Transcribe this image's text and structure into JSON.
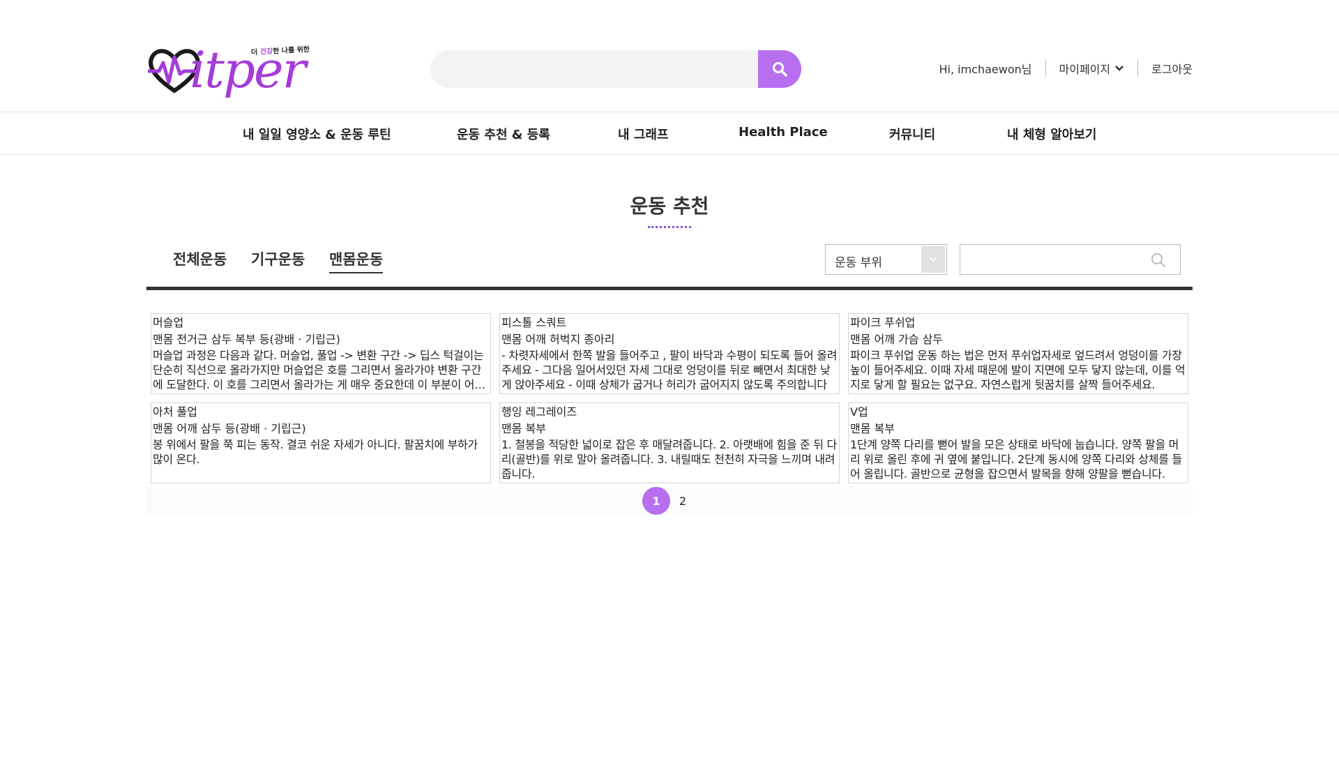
{
  "brand": {
    "name": "Fitper",
    "logo_text": "itper",
    "tagline_pre": "더 ",
    "tagline_highlight": "건강",
    "tagline_post": "한 나를 위한"
  },
  "header": {
    "search_placeholder": "",
    "greeting": "Hi, imchaewon님",
    "mypage_label": "마이페이지",
    "logout_label": "로그아웃"
  },
  "nav": {
    "items": [
      {
        "label": "내 일일 영양소 & 운동 루틴"
      },
      {
        "label": "운동 추천 & 등록"
      },
      {
        "label": "내 그래프"
      },
      {
        "label": "Health Place"
      },
      {
        "label": "커뮤니티"
      },
      {
        "label": "내 체형 알아보기"
      }
    ]
  },
  "page": {
    "title": "운동 추천"
  },
  "tabs": [
    {
      "label": "전체운동",
      "active": false
    },
    {
      "label": "기구운동",
      "active": false
    },
    {
      "label": "맨몸운동",
      "active": true
    }
  ],
  "filters": {
    "body_part_label": "운동 부위",
    "search_placeholder": ""
  },
  "exercises": [
    {
      "name": "머슬업",
      "target": "맨몸 전거근 삼두 복부 등(광배 · 기립근)",
      "description": "머슬업 과정은 다음과 같다. 머슬업, 풀업 -> 변환 구간 -> 딥스 턱걸이는 단순히 직선으로 올라가지만 머슬업은 호를 그리면서 올라가야 변환 구간에 도달한다. 이 호를 그리면서 올라가는 게 매우 중요한데 이 부분이 어렵다."
    },
    {
      "name": "피스톨 스쿼트",
      "target": "맨몸 어깨 허벅지 종아리",
      "description": "- 차렷자세에서 한쪽 발을 들어주고 , 팔이 바닥과 수평이 되도록 들어 올려주세요 - 그다음 일어서있던 자세 그대로 엉덩이를 뒤로 빼면서 최대한 낮게 앉아주세요 - 이때 상체가 굽거나 허리가 굽어지지 않도록 주의합니다"
    },
    {
      "name": "파이크 푸쉬업",
      "target": "맨몸 어깨 가슴 삼두",
      "description": "파이크 푸쉬업 운동 하는 법은 먼저 푸쉬업자세로 엎드려서 엉덩이를 가장 높이 들어주세요. 이때 자세 때문에 발이 지면에 모두 닿지 않는데, 이를 억지로 닿게 할 필요는 없구요. 자연스럽게 뒷꿈치를 살짝 들어주세요."
    },
    {
      "name": "아처 풀업",
      "target": "맨몸 어깨 삼두 등(광배 · 기립근)",
      "description": "봉 위에서 팔을 쭉 피는 동작. 결코 쉬운 자세가 아니다. 팔꿈치에 부하가 많이 온다."
    },
    {
      "name": "행잉 레그레이즈",
      "target": "맨몸 복부",
      "description": "1. 철봉을 적당한 넓이로 잡은 후 매달려줍니다. 2. 아랫배에 힘을 준 뒤 다리(골반)를 위로 말아 올려줍니다. 3. 내릴때도 천천히 자극을 느끼며 내려줍니다."
    },
    {
      "name": "V업",
      "target": "맨몸 복부",
      "description": "1단계 양쪽 다리를 뻗어 발을 모은 상태로 바닥에 눕습니다. 양쪽 팔을 머리 위로 올린 후에 귀 옆에 붙입니다. 2단계 동시에 양쪽 다리와 상체를 들어 올립니다. 골반으로 균형을 잡으면서 발목을 향해 양팔을 뻗습니다."
    }
  ],
  "pagination": {
    "pages": [
      "1",
      "2"
    ],
    "current": "1"
  },
  "colors": {
    "accent": "#b76ff0",
    "brand": "#a53bd9",
    "title_dots": "#8a4fe0"
  }
}
